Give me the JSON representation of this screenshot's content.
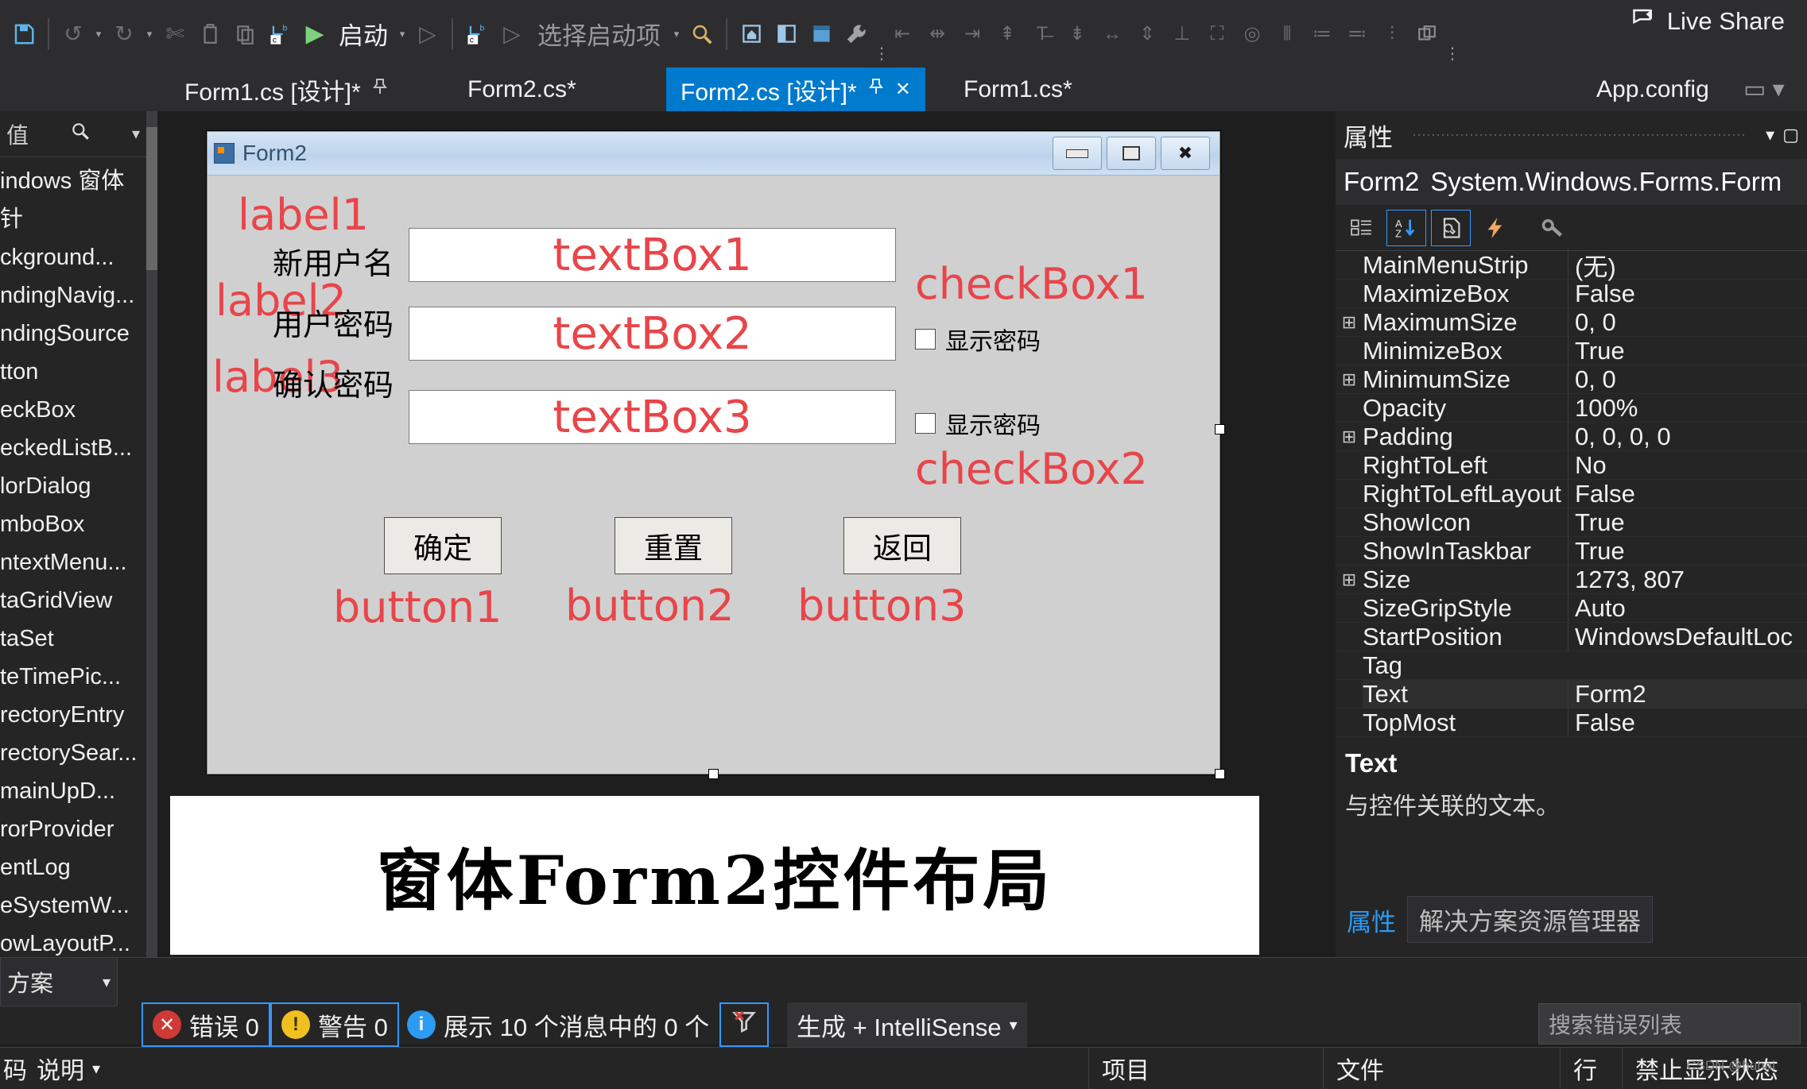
{
  "toolbar": {
    "icons": [
      "save-icon",
      "undo-icon",
      "redo-icon",
      "cut-icon",
      "copy-icon",
      "paste-icon",
      "build-config-icon"
    ],
    "start_label": "启动",
    "select_startup_label": "选择启动项",
    "live_share_label": "Live Share",
    "align_icons": [
      "align-left",
      "align-center",
      "align-right",
      "align-top",
      "align-middle",
      "align-bottom",
      "make-same-width",
      "make-same-height",
      "make-same-size",
      "size-to-grid",
      "horizontal-spacing",
      "vertical-spacing",
      "tab-order",
      "bring-to-front"
    ]
  },
  "left_panel_header": {
    "caret": "▾",
    "pin": "📌",
    "close": "✕"
  },
  "toolbox": {
    "search_value": "值",
    "search_icon": "search-icon",
    "items": [
      "indows 窗体",
      "针",
      "ckground...",
      "ndingNavig...",
      "ndingSource",
      "tton",
      "eckBox",
      "eckedListB...",
      "lorDialog",
      "mboBox",
      "ntextMenu...",
      "taGridView",
      "taSet",
      "teTimePic...",
      "rectoryEntry",
      "rectorySear...",
      "mainUpD...",
      "rorProvider",
      "entLog",
      "eSystemW...",
      "owLayoutP..."
    ]
  },
  "tabs": [
    {
      "label": "Form1.cs [设计]*",
      "active": false,
      "pin": "⊥"
    },
    {
      "label": "Form2.cs*",
      "active": false,
      "pin": ""
    },
    {
      "label": "Form2.cs [设计]*",
      "active": true,
      "pin": "⊥",
      "close": "✕"
    },
    {
      "label": "Form1.cs*",
      "active": false,
      "pin": ""
    },
    {
      "label": "App.config",
      "active": false,
      "pin": ""
    }
  ],
  "designer": {
    "form": {
      "title": "Form2",
      "minimize_icon": "minimize-icon",
      "maximize_icon": "maximize-icon",
      "close_icon": "close-icon",
      "labels": [
        {
          "text": "新用户名"
        },
        {
          "text": "用户密码"
        },
        {
          "text": "确认密码"
        }
      ],
      "annotations": [
        "label1",
        "label2",
        "label3",
        "textBox1",
        "textBox2",
        "textBox3",
        "checkBox1",
        "checkBox2",
        "button1",
        "button2",
        "button3"
      ],
      "textboxes": [
        {
          "placeholder": "textBox1"
        },
        {
          "placeholder": "textBox2"
        },
        {
          "placeholder": "textBox3"
        }
      ],
      "checkboxes": [
        {
          "label": "显示密码",
          "checked": false
        },
        {
          "label": "显示密码",
          "checked": false
        }
      ],
      "buttons": [
        {
          "label": "确定"
        },
        {
          "label": "重置"
        },
        {
          "label": "返回"
        }
      ]
    },
    "caption": "窗体Form2控件布局"
  },
  "properties": {
    "panel_title": "属性",
    "object_name": "Form2",
    "object_type": "System.Windows.Forms.Form",
    "toolbar_icons": [
      "categorized-icon",
      "alphabetical-icon",
      "properties-icon",
      "events-icon",
      "property-pages-icon"
    ],
    "rows": [
      {
        "expand": "",
        "key": "MainMenuStrip",
        "value": "(无)"
      },
      {
        "expand": "",
        "key": "MaximizeBox",
        "value": "False"
      },
      {
        "expand": "⊞",
        "key": "MaximumSize",
        "value": "0, 0"
      },
      {
        "expand": "",
        "key": "MinimizeBox",
        "value": "True"
      },
      {
        "expand": "⊞",
        "key": "MinimumSize",
        "value": "0, 0"
      },
      {
        "expand": "",
        "key": "Opacity",
        "value": "100%"
      },
      {
        "expand": "⊞",
        "key": "Padding",
        "value": "0, 0, 0, 0"
      },
      {
        "expand": "",
        "key": "RightToLeft",
        "value": "No"
      },
      {
        "expand": "",
        "key": "RightToLeftLayout",
        "value": "False"
      },
      {
        "expand": "",
        "key": "ShowIcon",
        "value": "True"
      },
      {
        "expand": "",
        "key": "ShowInTaskbar",
        "value": "True"
      },
      {
        "expand": "⊞",
        "key": "Size",
        "value": "1273, 807"
      },
      {
        "expand": "",
        "key": "SizeGripStyle",
        "value": "Auto"
      },
      {
        "expand": "",
        "key": "StartPosition",
        "value": "WindowsDefaultLoc"
      },
      {
        "expand": "",
        "key": "Tag",
        "value": ""
      },
      {
        "expand": "",
        "key": "Text",
        "value": "Form2",
        "highlight": true
      },
      {
        "expand": "",
        "key": "TopMost",
        "value": "False"
      }
    ],
    "description_title": "Text",
    "description_body": "与控件关联的文本。",
    "bottom_tabs": [
      {
        "label": "属性",
        "active": true
      },
      {
        "label": "解决方案资源管理器",
        "active": false
      }
    ]
  },
  "error_list": {
    "left_label": "方案",
    "bottom_left_label": "明",
    "errors_label": "错误 0",
    "warnings_label": "警告 0",
    "messages_label": "展示 10 个消息中的 0 个",
    "filter_icon": "clear-filter-icon",
    "scope_label": "生成 + IntelliSense",
    "search_placeholder": "搜索错误列表",
    "columns": [
      {
        "label": "码"
      },
      {
        "label": "说明",
        "sort": "▾"
      },
      {
        "label": "项目"
      },
      {
        "label": "文件"
      },
      {
        "label": "行"
      },
      {
        "label": "禁止显示状态"
      }
    ],
    "description_dropdown_label": "说明"
  },
  "colors": {
    "accent": "#007acc",
    "annotation_red": "#e8454a",
    "error_red": "#d03a36",
    "warning_yellow": "#f0c020",
    "info_blue": "#2b9bf4",
    "panel_bg": "#252526",
    "toolbar_bg": "#2d2d30",
    "canvas_bg": "#1e1e1e"
  },
  "watermark": "CSDN @huhai"
}
